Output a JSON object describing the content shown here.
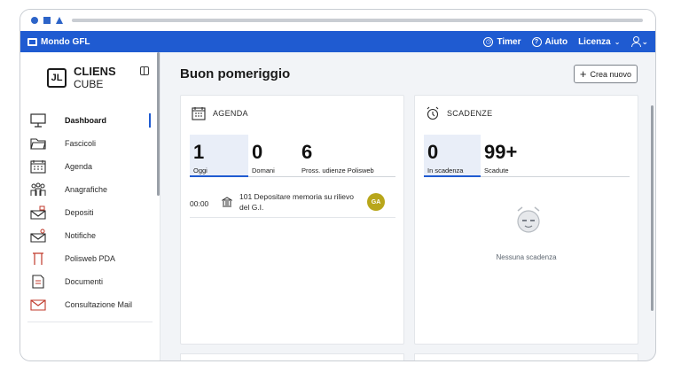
{
  "browser": {
    "icons": [
      "circle-icon",
      "square-icon",
      "triangle-icon"
    ]
  },
  "appbar": {
    "app_name": "Mondo GFL",
    "timer_label": "Timer",
    "help_label": "Aiuto",
    "license_label": "Licenza",
    "accent": "#1f5bd1"
  },
  "sidebar": {
    "brand_line1": "CLIENS",
    "brand_line2": "CUBE",
    "brand_mark": "JL",
    "items": [
      {
        "label": "Dashboard",
        "icon": "monitor-icon",
        "active": true
      },
      {
        "label": "Fascicoli",
        "icon": "folder-icon"
      },
      {
        "label": "Agenda",
        "icon": "calendar-icon"
      },
      {
        "label": "Anagrafiche",
        "icon": "people-icon"
      },
      {
        "label": "Depositi",
        "icon": "deposit-mail-icon"
      },
      {
        "label": "Notifiche",
        "icon": "notification-mail-icon"
      },
      {
        "label": "Polisweb PDA",
        "icon": "polisweb-icon"
      },
      {
        "label": "Documenti",
        "icon": "document-icon"
      },
      {
        "label": "Consultazione Mail",
        "icon": "envelope-icon"
      }
    ]
  },
  "main": {
    "greeting": "Buon pomeriggio",
    "create_label": "Crea nuovo"
  },
  "agenda": {
    "title": "AGENDA",
    "stats": [
      {
        "value": "1",
        "label": "Oggi"
      },
      {
        "value": "0",
        "label": "Domani"
      },
      {
        "value": "6",
        "label": "Pross. udienze Polisweb"
      }
    ],
    "event": {
      "time": "00:00",
      "description": "101 Depositare memoria su rilievo del G.I.",
      "badge": "GA",
      "badge_color": "#b8a61a"
    }
  },
  "scadenze": {
    "title": "SCADENZE",
    "stats": [
      {
        "value": "0",
        "label": "In scadenza"
      },
      {
        "value": "99+",
        "label": "Scadute"
      }
    ],
    "empty_text": "Nessuna scadenza"
  }
}
